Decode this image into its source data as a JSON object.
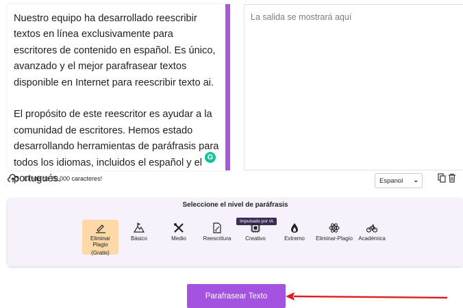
{
  "input": {
    "text": "Nuestro equipo ha desarrollado reescribir textos en línea exclusivamente para escritores de contenido en español. Es único, avanzado y el mejor parafrasear textos disponible en Internet para reescribir texto ai.\n\nEl propósito de este reescritor es ayudar a la comunidad de escritores. Hemos estado desarrollando herramientas de paráfrasis para todos los idiomas, incluidos el español y el portugués."
  },
  "output": {
    "placeholder": "La salida se mostrará aquí"
  },
  "footer": {
    "char_limit": "Límite de 20,000 caracteres!"
  },
  "language": {
    "selected": "Espanol"
  },
  "levels": {
    "title": "Seleccione el nivel de paráfrasis",
    "ai_badge": "Impulsado por IA",
    "modes": [
      {
        "label": "Eliminar Plagio",
        "sub": "(Gratis)",
        "active": true
      },
      {
        "label": "Básico"
      },
      {
        "label": "Medio"
      },
      {
        "label": "Reescritura"
      },
      {
        "label": "Creativo"
      },
      {
        "label": "Extremo"
      },
      {
        "label": "Eliminar-Plagio"
      },
      {
        "label": "Académica"
      }
    ]
  },
  "action": {
    "button_label": "Parafrasear Texto"
  },
  "colors": {
    "accent": "#a452e0",
    "active_mode": "#fcd9a6",
    "arrow": "#e11b1b"
  }
}
